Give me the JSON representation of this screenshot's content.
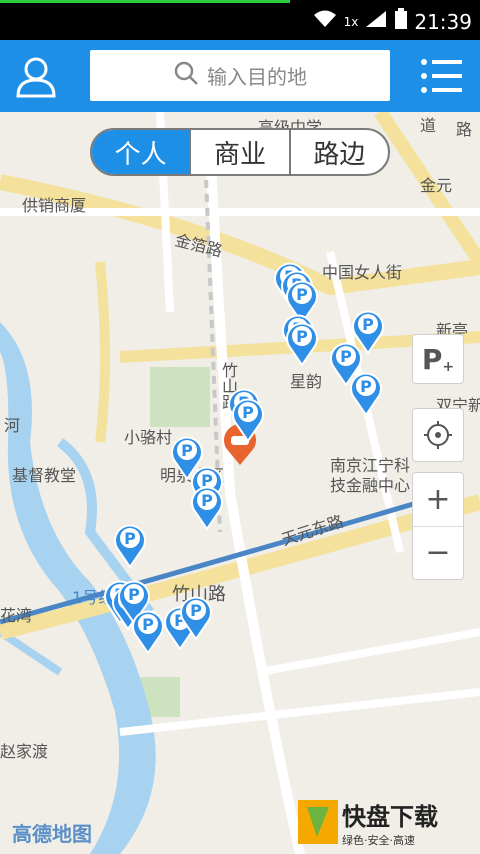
{
  "status": {
    "time": "21:39",
    "net": "1x"
  },
  "search": {
    "placeholder": "输入目的地"
  },
  "tabs": [
    "个人",
    "商业",
    "路边"
  ],
  "map": {
    "labels": {
      "gaojizhongxue": "高级中学",
      "gongxiao": "供销商厦",
      "jinxiu": "金箔路",
      "zhongguonvren": "中国女人街",
      "jinyuan": "金元",
      "xinting": "新亭",
      "xingyun": "星韵",
      "shuangning": "双宁新",
      "zhushan_v": "竹山路",
      "xiaoluocun": "小骆村",
      "minquan": "明泉小区",
      "jidu": "基督教堂",
      "nanjing1": "南京江宁科",
      "nanjing2": "技金融中心",
      "tianyuan": "天元东路",
      "zhushanlu": "竹山路",
      "yihao": "1号线",
      "hua": "花湾",
      "zhaojia": "赵家渡",
      "he": "河",
      "dao": "道",
      "lu": "路"
    },
    "pin_glyph": "P",
    "parking_glyph": "P"
  },
  "controls": {
    "zoom_in": "+",
    "zoom_out": "−"
  },
  "footer": {
    "map_logo": "高德地图",
    "wm_title": "快盘下载",
    "wm_sub": "绿色·安全·高速"
  },
  "colors": {
    "accent": "#1e8fe6",
    "pin": "#2f8fe6",
    "road_yellow": "#f3e19c",
    "water": "#a8d3f0"
  }
}
